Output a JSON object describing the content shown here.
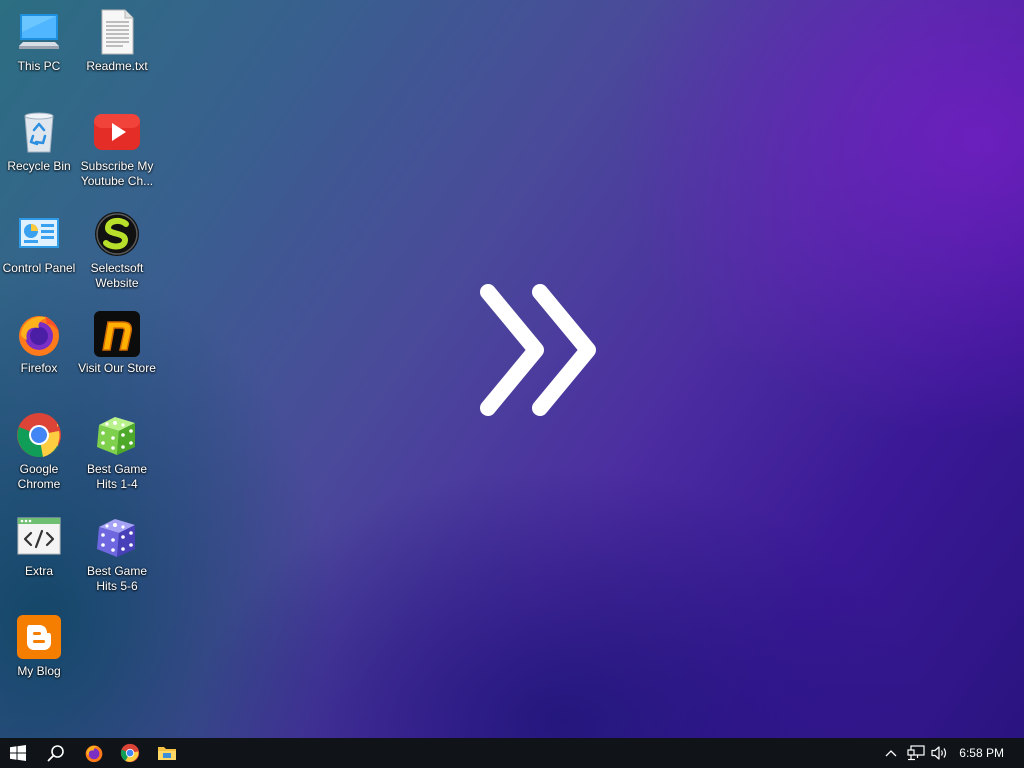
{
  "desktop": {
    "icons": [
      {
        "label": "This PC",
        "icon": "computer-icon"
      },
      {
        "label": "Readme.txt",
        "icon": "text-file-icon"
      },
      {
        "label": "Recycle Bin",
        "icon": "recycle-bin-icon"
      },
      {
        "label": "Subscribe My Youtube Ch...",
        "icon": "youtube-icon"
      },
      {
        "label": "Control Panel",
        "icon": "control-panel-icon"
      },
      {
        "label": "Selectsoft Website",
        "icon": "selectsoft-icon"
      },
      {
        "label": "Firefox",
        "icon": "firefox-icon"
      },
      {
        "label": "Visit Our Store",
        "icon": "store-icon"
      },
      {
        "label": "Google Chrome",
        "icon": "chrome-icon"
      },
      {
        "label": "Best Game Hits 1-4",
        "icon": "green-dice-icon"
      },
      {
        "label": "Extra",
        "icon": "code-window-icon"
      },
      {
        "label": "Best Game Hits 5-6",
        "icon": "blue-dice-icon"
      },
      {
        "label": "My Blog",
        "icon": "blogger-icon"
      }
    ],
    "center_graphic": "double-chevron-right-icon"
  },
  "taskbar": {
    "pinned": [
      "windows-start-icon",
      "search-icon",
      "firefox-icon",
      "chrome-icon",
      "file-explorer-icon"
    ],
    "tray": [
      "chevron-up-icon",
      "network-icon",
      "volume-icon"
    ],
    "clock": "6:58 PM"
  }
}
